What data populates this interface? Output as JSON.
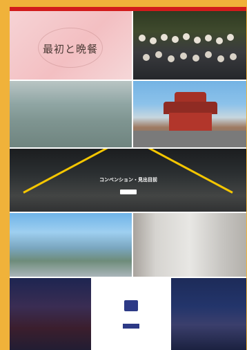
{
  "tiles": {
    "logo": {
      "title": "最初と晩餐",
      "sub": ""
    },
    "road": {
      "line1": "",
      "line2": "コンベンション・見出目前",
      "button": ""
    },
    "mountain": {
      "caption": ""
    },
    "center": {
      "label": "",
      "button": ""
    }
  },
  "colors": {
    "frame": "#f0b23a",
    "accent_red": "#d21b1b",
    "navy": "#2d3a86"
  }
}
